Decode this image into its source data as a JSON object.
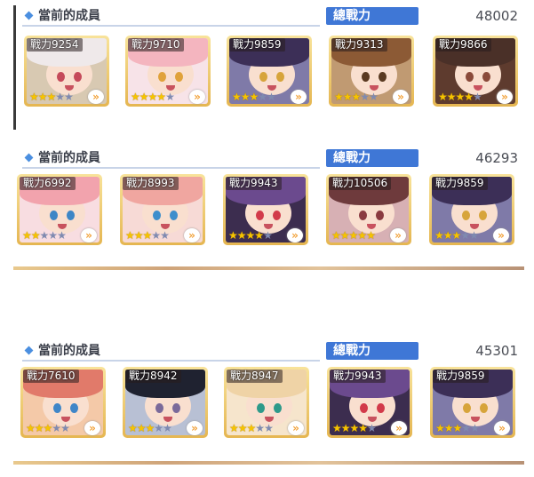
{
  "teams": [
    {
      "header": {
        "title": "當前的成員",
        "total_label": "總戰力",
        "total_power": "48002"
      },
      "members": [
        {
          "power": "戰力9254",
          "stars": 3,
          "arrow": "»",
          "hair": "#efe9ea",
          "bg": "#d8c9b2",
          "eye": "#c54a5a"
        },
        {
          "power": "戰力9710",
          "stars": 4,
          "arrow": "»",
          "hair": "#f4b5bf",
          "bg": "#f7e3e8",
          "eye": "#e0a23a"
        },
        {
          "power": "戰力9859",
          "stars": 3,
          "arrow": "»",
          "hair": "#3c2f57",
          "bg": "#7f7aa8",
          "eye": "#d7a43b"
        },
        {
          "power": "戰力9313",
          "stars": 3,
          "arrow": "»",
          "hair": "#8c5a35",
          "bg": "#c09a72",
          "eye": "#5a3a22"
        },
        {
          "power": "戰力9866",
          "stars": 4,
          "arrow": "»",
          "hair": "#4a3028",
          "bg": "#5e3b2e",
          "eye": "#8a4a3a"
        }
      ]
    },
    {
      "header": {
        "title": "當前的成員",
        "total_label": "總戰力",
        "total_power": "46293"
      },
      "members": [
        {
          "power": "戰力6992",
          "stars": 2,
          "arrow": "»",
          "hair": "#f2a3ad",
          "bg": "#f8dde1",
          "eye": "#3d86c6"
        },
        {
          "power": "戰力8993",
          "stars": 3,
          "arrow": "»",
          "hair": "#f0a6a0",
          "bg": "#f7dad6",
          "eye": "#3e8ecc"
        },
        {
          "power": "戰力9943",
          "stars": 4,
          "arrow": "»",
          "hair": "#6b4a8e",
          "bg": "#3c2d4f",
          "eye": "#d23a4a"
        },
        {
          "power": "戰力10506",
          "stars": 5,
          "arrow": "»",
          "hair": "#6e3a3c",
          "bg": "#d7b0b4",
          "eye": "#8a3a40"
        },
        {
          "power": "戰力9859",
          "stars": 3,
          "arrow": "»",
          "hair": "#3c2f57",
          "bg": "#7f7aa8",
          "eye": "#d7a43b"
        }
      ]
    },
    {
      "header": {
        "title": "當前的成員",
        "total_label": "總戰力",
        "total_power": "45301"
      },
      "members": [
        {
          "power": "戰力7610",
          "stars": 3,
          "arrow": "»",
          "hair": "#e17a6a",
          "bg": "#f4c9a8",
          "eye": "#3f86c8"
        },
        {
          "power": "戰力8942",
          "stars": 3,
          "arrow": "»",
          "hair": "#1f2230",
          "bg": "#b8c0d4",
          "eye": "#7a6a9a"
        },
        {
          "power": "戰力8947",
          "stars": 3,
          "arrow": "»",
          "hair": "#efd3a6",
          "bg": "#f6e5cc",
          "eye": "#2e9a8a"
        },
        {
          "power": "戰力9943",
          "stars": 4,
          "arrow": "»",
          "hair": "#6b4a8e",
          "bg": "#3c2d4f",
          "eye": "#d23a4a"
        },
        {
          "power": "戰力9859",
          "stars": 3,
          "arrow": "»",
          "hair": "#3c2f57",
          "bg": "#7f7aa8",
          "eye": "#d7a43b"
        }
      ]
    }
  ]
}
